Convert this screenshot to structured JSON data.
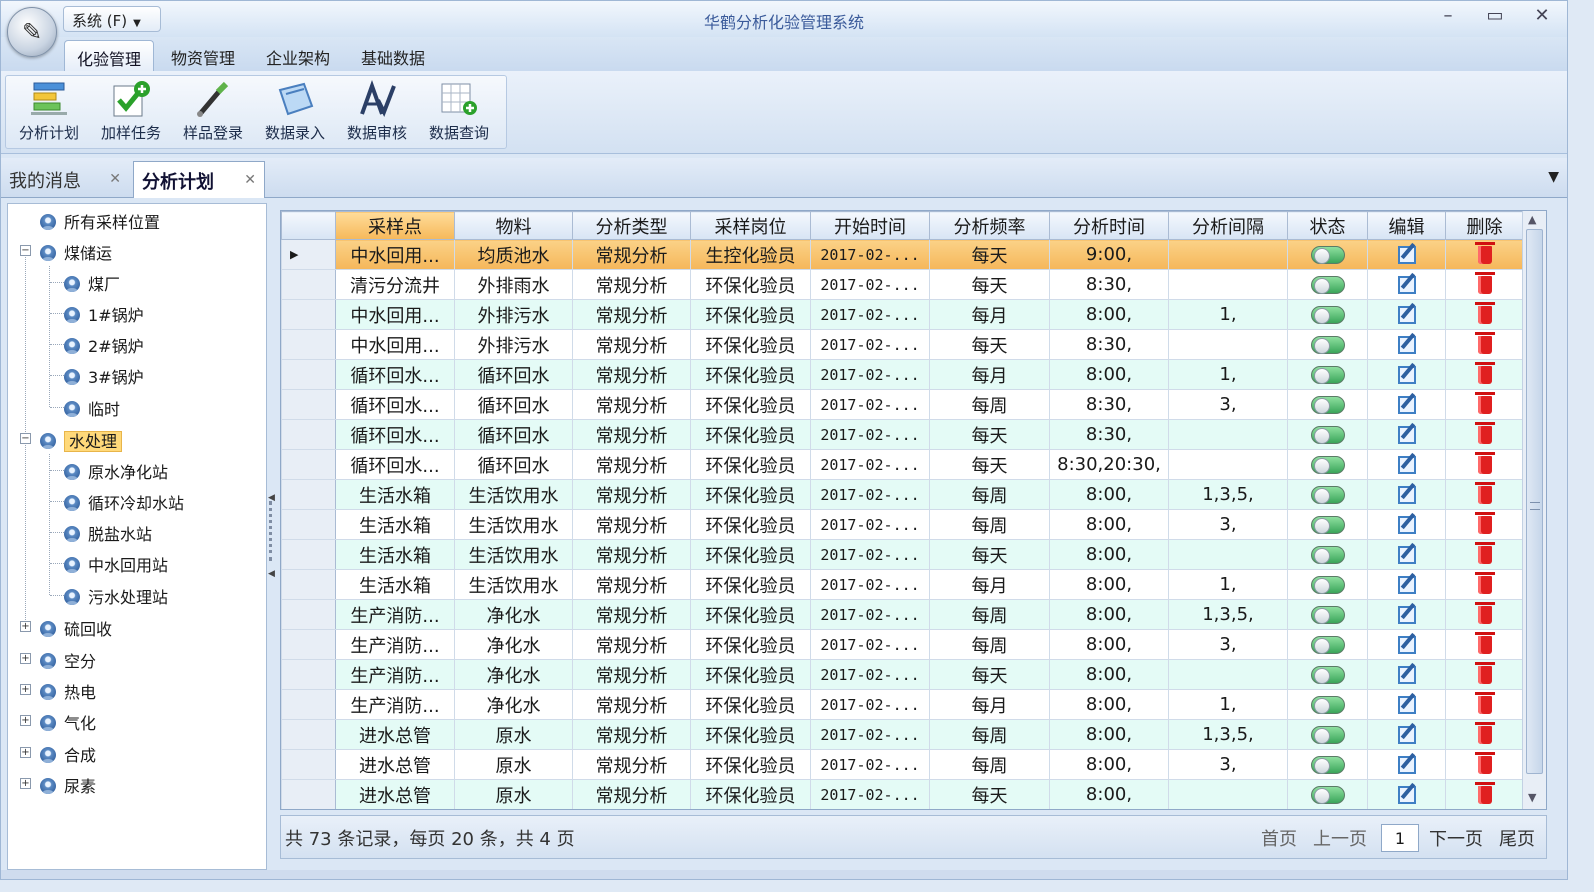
{
  "window": {
    "title": "华鹤分析化验管理系统",
    "system_menu": "系统 (F)"
  },
  "ribbon_tabs": [
    "化验管理",
    "物资管理",
    "企业架构",
    "基础数据"
  ],
  "ribbon_buttons": [
    {
      "label": "分析计划",
      "icon": "analysis-plan-icon"
    },
    {
      "label": "加样任务",
      "icon": "add-sample-task-icon"
    },
    {
      "label": "样品登录",
      "icon": "sample-login-icon"
    },
    {
      "label": "数据录入",
      "icon": "data-entry-icon"
    },
    {
      "label": "数据审核",
      "icon": "data-review-icon"
    },
    {
      "label": "数据查询",
      "icon": "data-query-icon"
    }
  ],
  "doc_tabs": [
    {
      "label": "我的消息"
    },
    {
      "label": "分析计划"
    }
  ],
  "tree": {
    "root": "所有采样位置",
    "nodes": [
      {
        "label": "煤储运",
        "children": [
          "煤厂",
          "1#锅炉",
          "2#锅炉",
          "3#锅炉",
          "临时"
        ]
      },
      {
        "label": "水处理",
        "children": [
          "原水净化站",
          "循环冷却水站",
          "脱盐水站",
          "中水回用站",
          "污水处理站"
        ]
      },
      {
        "label": "硫回收"
      },
      {
        "label": "空分"
      },
      {
        "label": "热电"
      },
      {
        "label": "气化"
      },
      {
        "label": "合成"
      },
      {
        "label": "尿素"
      }
    ]
  },
  "grid": {
    "columns": [
      "采样点",
      "物料",
      "分析类型",
      "采样岗位",
      "开始时间",
      "分析频率",
      "分析时间",
      "分析间隔",
      "状态",
      "编辑",
      "删除"
    ],
    "rows": [
      [
        "中水回用...",
        "均质池水",
        "常规分析",
        "生控化验员",
        "2017-02-...",
        "每天",
        "9:00,",
        ""
      ],
      [
        "清污分流井",
        "外排雨水",
        "常规分析",
        "环保化验员",
        "2017-02-...",
        "每天",
        "8:30,",
        ""
      ],
      [
        "中水回用...",
        "外排污水",
        "常规分析",
        "环保化验员",
        "2017-02-...",
        "每月",
        "8:00,",
        "1,"
      ],
      [
        "中水回用...",
        "外排污水",
        "常规分析",
        "环保化验员",
        "2017-02-...",
        "每天",
        "8:30,",
        ""
      ],
      [
        "循环回水...",
        "循环回水",
        "常规分析",
        "环保化验员",
        "2017-02-...",
        "每月",
        "8:00,",
        "1,"
      ],
      [
        "循环回水...",
        "循环回水",
        "常规分析",
        "环保化验员",
        "2017-02-...",
        "每周",
        "8:30,",
        "3,"
      ],
      [
        "循环回水...",
        "循环回水",
        "常规分析",
        "环保化验员",
        "2017-02-...",
        "每天",
        "8:30,",
        ""
      ],
      [
        "循环回水...",
        "循环回水",
        "常规分析",
        "环保化验员",
        "2017-02-...",
        "每天",
        "8:30,20:30,",
        ""
      ],
      [
        "生活水箱",
        "生活饮用水",
        "常规分析",
        "环保化验员",
        "2017-02-...",
        "每周",
        "8:00,",
        "1,3,5,"
      ],
      [
        "生活水箱",
        "生活饮用水",
        "常规分析",
        "环保化验员",
        "2017-02-...",
        "每周",
        "8:00,",
        "3,"
      ],
      [
        "生活水箱",
        "生活饮用水",
        "常规分析",
        "环保化验员",
        "2017-02-...",
        "每天",
        "8:00,",
        ""
      ],
      [
        "生活水箱",
        "生活饮用水",
        "常规分析",
        "环保化验员",
        "2017-02-...",
        "每月",
        "8:00,",
        "1,"
      ],
      [
        "生产消防...",
        "净化水",
        "常规分析",
        "环保化验员",
        "2017-02-...",
        "每周",
        "8:00,",
        "1,3,5,"
      ],
      [
        "生产消防...",
        "净化水",
        "常规分析",
        "环保化验员",
        "2017-02-...",
        "每周",
        "8:00,",
        "3,"
      ],
      [
        "生产消防...",
        "净化水",
        "常规分析",
        "环保化验员",
        "2017-02-...",
        "每天",
        "8:00,",
        ""
      ],
      [
        "生产消防...",
        "净化水",
        "常规分析",
        "环保化验员",
        "2017-02-...",
        "每月",
        "8:00,",
        "1,"
      ],
      [
        "进水总管",
        "原水",
        "常规分析",
        "环保化验员",
        "2017-02-...",
        "每周",
        "8:00,",
        "1,3,5,"
      ],
      [
        "进水总管",
        "原水",
        "常规分析",
        "环保化验员",
        "2017-02-...",
        "每周",
        "8:00,",
        "3,"
      ],
      [
        "进水总管",
        "原水",
        "常规分析",
        "环保化验员",
        "2017-02-...",
        "每天",
        "8:00,",
        ""
      ]
    ]
  },
  "pager": {
    "info": "共 73 条记录，每页 20 条，共 4 页",
    "first": "首页",
    "prev": "上一页",
    "page": "1",
    "next": "下一页",
    "last": "尾页"
  },
  "colors": {
    "selected_row": "#f7c46c",
    "alt_row": "#e4fbf6",
    "toggle_on": "#3aa55a",
    "delete": "#e02020"
  }
}
